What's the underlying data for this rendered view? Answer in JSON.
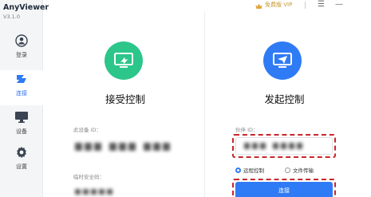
{
  "app": {
    "name": "AnyViewer",
    "version": "V3.1.0"
  },
  "topbar": {
    "vip_label": "免费版 VIP",
    "menu_glyph": "☰",
    "minimize_glyph": "—"
  },
  "sidebar": {
    "items": [
      {
        "label": "登录",
        "icon": "user-icon"
      },
      {
        "label": "连接",
        "icon": "connect-icon"
      },
      {
        "label": "设备",
        "icon": "monitor-icon"
      },
      {
        "label": "设置",
        "icon": "gear-icon"
      }
    ],
    "active_index": 1
  },
  "accept_panel": {
    "title": "接受控制",
    "device_id_label": "此设备 ID：",
    "temp_code_label": "临时安全码："
  },
  "initiate_panel": {
    "title": "发起控制",
    "partner_id_label": "伙伴 ID：",
    "radio_options": [
      {
        "label": "远程控制",
        "selected": true
      },
      {
        "label": "文件传输",
        "selected": false
      }
    ],
    "connect_label": "连接"
  },
  "colors": {
    "accent": "#2f7bf5",
    "green": "#2cc68a",
    "highlight": "#c8262b",
    "vip": "#c7962f"
  }
}
